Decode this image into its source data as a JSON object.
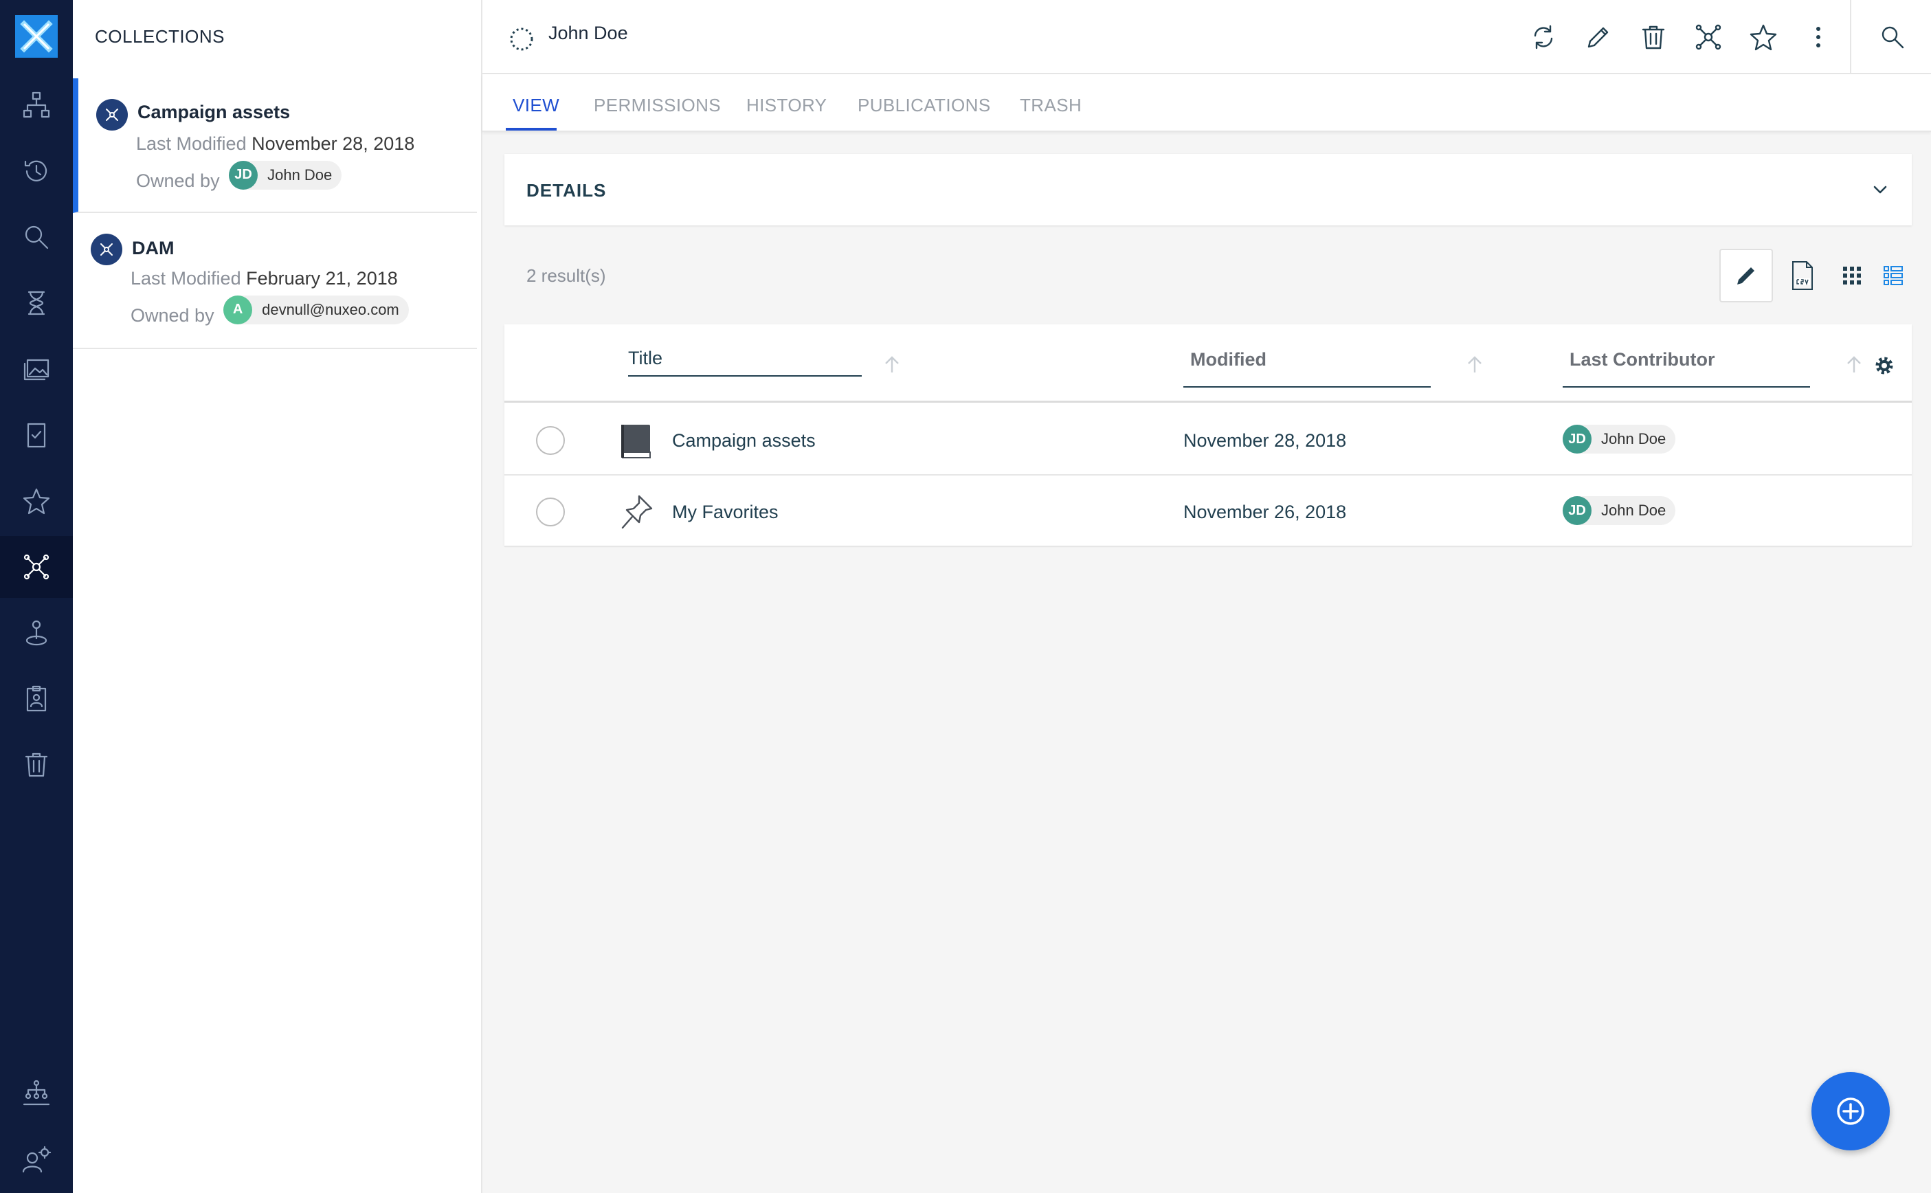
{
  "collections": {
    "title": "COLLECTIONS",
    "items": [
      {
        "title": "Campaign assets",
        "modified_label": "Last Modified",
        "modified_date": "November 28, 2018",
        "owned_label": "Owned by",
        "owner_initials": "JD",
        "owner_name": "John Doe"
      },
      {
        "title": "DAM",
        "modified_label": "Last Modified",
        "modified_date": "February 21, 2018",
        "owned_label": "Owned by",
        "owner_initials": "A",
        "owner_name": "devnull@nuxeo.com"
      }
    ]
  },
  "header": {
    "title": "John Doe"
  },
  "tabs": [
    "VIEW",
    "PERMISSIONS",
    "HISTORY",
    "PUBLICATIONS",
    "TRASH"
  ],
  "details": {
    "label": "DETAILS"
  },
  "results": {
    "count": "2 result(s)"
  },
  "table": {
    "columns": {
      "title": "Title",
      "modified": "Modified",
      "contributor": "Last Contributor"
    },
    "rows": [
      {
        "title": "Campaign assets",
        "modified": "November 28, 2018",
        "contributor_initials": "JD",
        "contributor": "John Doe",
        "icon": "book-icon"
      },
      {
        "title": "My Favorites",
        "modified": "November 26, 2018",
        "contributor_initials": "JD",
        "contributor": "John Doe",
        "icon": "pin-icon"
      }
    ]
  },
  "colors": {
    "nav_bg": "#0f1c3d",
    "accent": "#1f6de6",
    "tab_active": "#1f4fd1",
    "avatar": "#3e9b8c"
  }
}
